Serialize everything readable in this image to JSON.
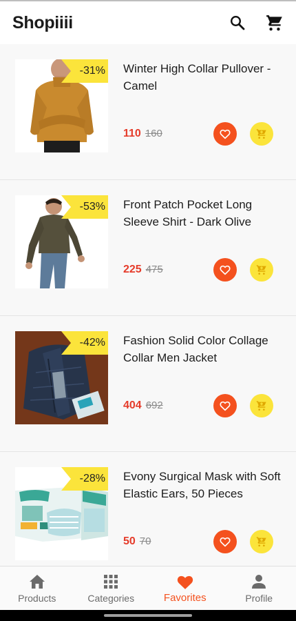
{
  "app": {
    "title": "Shopiiii"
  },
  "icons": {
    "search": "search-icon",
    "cart": "shopping-cart-icon",
    "favorite": "heart-outline-icon",
    "add_to_cart": "add-cart-icon"
  },
  "colors": {
    "accent": "#f4511e",
    "price": "#e53b2a",
    "badge": "#fbe43b",
    "cart_button": "#fbe43b"
  },
  "products": [
    {
      "name": "Winter High Collar Pullover - Camel",
      "price": "110",
      "old_price": "160",
      "discount": "-31%"
    },
    {
      "name": "Front Patch Pocket Long Sleeve Shirt - Dark Olive",
      "price": "225",
      "old_price": "475",
      "discount": "-53%"
    },
    {
      "name": "Fashion Solid Color Collage Collar Men Jacket",
      "price": "404",
      "old_price": "692",
      "discount": "-42%"
    },
    {
      "name": "Evony Surgical Mask with Soft Elastic Ears, 50 Pieces",
      "price": "50",
      "old_price": "70",
      "discount": "-28%"
    }
  ],
  "bottom_nav": [
    {
      "label": "Products",
      "icon": "home-icon",
      "active": false
    },
    {
      "label": "Categories",
      "icon": "grid-icon",
      "active": false
    },
    {
      "label": "Favorites",
      "icon": "heart-icon",
      "active": true
    },
    {
      "label": "Profile",
      "icon": "person-icon",
      "active": false
    }
  ]
}
